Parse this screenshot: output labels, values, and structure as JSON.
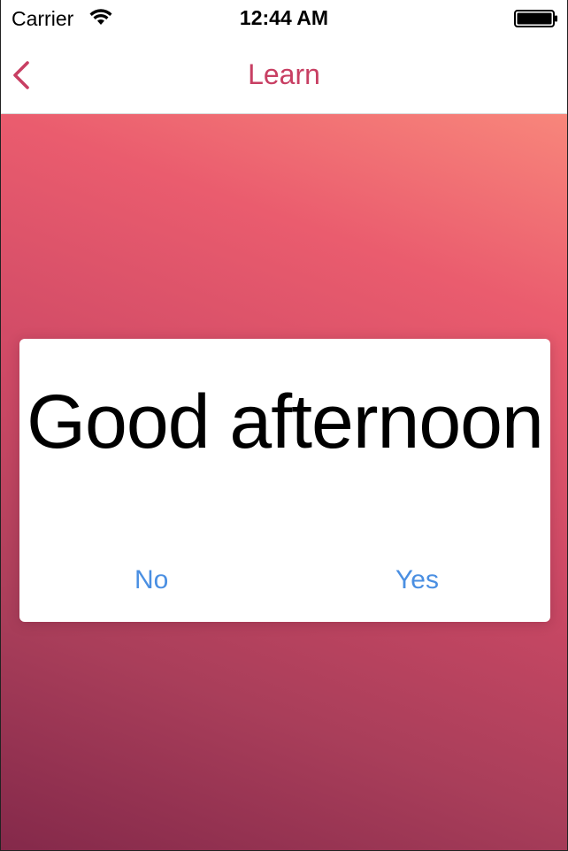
{
  "status_bar": {
    "carrier": "Carrier",
    "time": "12:44 AM",
    "wifi_icon": "wifi-icon",
    "battery_icon": "battery-full-icon"
  },
  "nav": {
    "title": "Learn",
    "back_icon": "chevron-left-icon",
    "accent_color": "#c83f63"
  },
  "card": {
    "phrase": "Good afternoon",
    "no_label": "No",
    "yes_label": "Yes",
    "button_color": "#4a8fe2"
  },
  "background": {
    "gradient_top": "#f8867b",
    "gradient_mid": "#cf4a66",
    "gradient_bottom": "#84294a"
  }
}
